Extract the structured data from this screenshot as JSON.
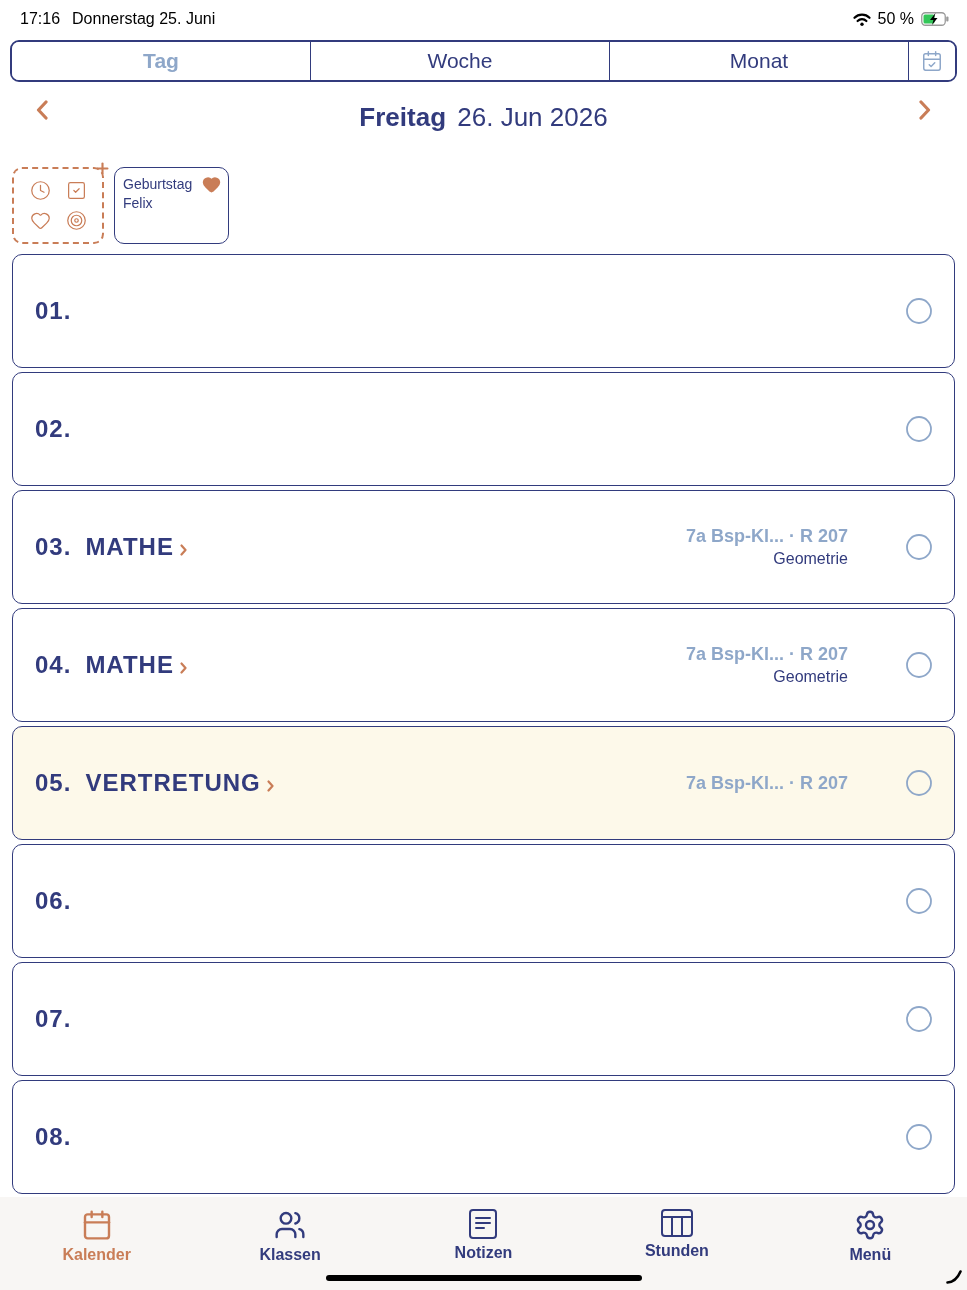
{
  "status_bar": {
    "time": "17:16",
    "date": "Donnerstag 25. Juni",
    "battery": "50 %"
  },
  "view_tabs": [
    {
      "label": "Tag",
      "selected": true
    },
    {
      "label": "Woche",
      "selected": false
    },
    {
      "label": "Monat",
      "selected": false
    }
  ],
  "date_header": {
    "title": "**Freitag** 26. Jun 2026"
  },
  "events": [
    {
      "kind": "birthday",
      "title": "Geburtstag Felix"
    }
  ],
  "lessons": [
    {
      "number": "01.",
      "highlighted": false,
      "checked": false
    },
    {
      "number": "02.",
      "highlighted": false,
      "checked": false
    },
    {
      "number": "03.",
      "subject": "MATHE",
      "details": "7a Bsp-Kl... · R 207",
      "topic": "Geometrie",
      "highlighted": false,
      "checked": false
    },
    {
      "number": "04.",
      "subject": "MATHE",
      "details": "7a Bsp-Kl... · R 207",
      "topic": "Geometrie",
      "highlighted": false,
      "checked": false
    },
    {
      "number": "05.",
      "subject": "VERTRETUNG",
      "details": "7a Bsp-Kl... · R 207",
      "highlighted": true,
      "checked": false
    },
    {
      "number": "06.",
      "highlighted": false,
      "checked": false
    },
    {
      "number": "07.",
      "highlighted": false,
      "checked": false
    },
    {
      "number": "08.",
      "highlighted": false,
      "checked": false
    }
  ],
  "tab_bar": [
    {
      "label": "Kalender",
      "selected": true
    },
    {
      "label": "Klassen",
      "selected": false
    },
    {
      "label": "Notizen",
      "selected": false
    },
    {
      "label": "Stunden",
      "selected": false
    },
    {
      "label": "Menü",
      "selected": false
    }
  ]
}
